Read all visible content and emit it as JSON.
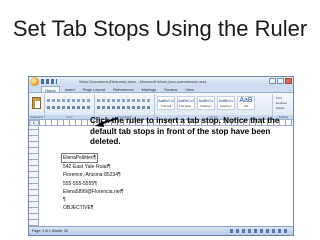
{
  "slide": {
    "title": "Set Tab Stops Using the Ruler",
    "callout": "Click the ruler to insert a tab stop. Notice that the default tab stops in front of the stop have been deleted."
  },
  "word": {
    "window_caption": "Word Document (Resume).docx - Microsoft Word (non-commercial use)",
    "tabs": [
      "Home",
      "Insert",
      "Page Layout",
      "References",
      "Mailings",
      "Review",
      "View"
    ],
    "groups": {
      "clipboard": "Clipboard",
      "font": "Font",
      "paragraph": "Paragraph",
      "styles": "Styles",
      "editing": "Editing"
    },
    "styles": [
      {
        "preview": "AaBbCcI",
        "name": "¶ Normal"
      },
      {
        "preview": "AaBbCcI",
        "name": "¶ No Spaci..."
      },
      {
        "preview": "AaBbCc",
        "name": "Heading 1"
      },
      {
        "preview": "AaBbCc",
        "name": "Heading 2"
      },
      {
        "preview": "AaB",
        "name": "Title"
      }
    ],
    "editing_items": [
      "Find",
      "Replace",
      "Select"
    ],
    "ruler_tab_glyph": "L",
    "document_lines": [
      "ElenaPellitteri¶",
      "542·East·Yale·Road¶",
      "Florence,·Arizona·85234¶",
      "555-555-5555¶",
      "Elena5899@Florencia.net¶",
      "¶",
      "OBJECTIVE¶"
    ],
    "status": "Page: 1 of 1    Words: 28"
  },
  "colors": {
    "ribbon_blue": "#dfe8f5",
    "arrow": "#000000",
    "office_button": "#e4a21c"
  }
}
